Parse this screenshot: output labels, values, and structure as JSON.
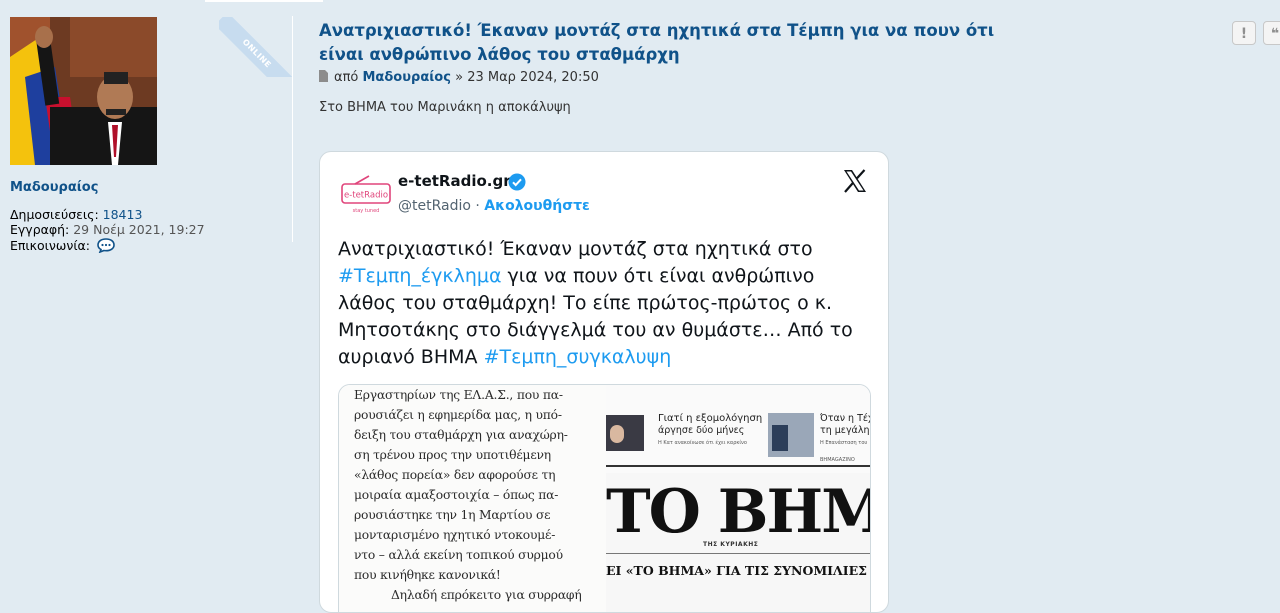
{
  "profile": {
    "username": "Μαδουραίος",
    "online_badge": "ONLINE",
    "fields": [
      {
        "label": "Δημοσιεύσεις:",
        "value": "18413"
      },
      {
        "label": "Εγγραφή:",
        "value": "29 Νοέμ 2021, 19:27"
      },
      {
        "label": "Επικοινωνία:",
        "value": ""
      }
    ]
  },
  "post": {
    "title": "Ανατριχιαστικό! Έκαναν μοντάζ στα ηχητικά στα Τέμπη για να πουν ότι είναι ανθρώπινο λάθος του σταθμάρχη",
    "meta_prefix": "από",
    "author": "Μαδουραίος",
    "meta_sep": "»",
    "date": "23 Μαρ 2024, 20:50",
    "text": "Στο ΒΗΜΑ του Μαρινάκη η αποκάλυψη",
    "quick_buttons": [
      "!",
      "❝"
    ]
  },
  "tweet": {
    "account_name": "e-tetRadio.gr",
    "logo_text": "e-tetRadio",
    "logo_tagline": "stay tuned",
    "handle": "@tetRadio",
    "dot": "·",
    "follow_label": "Ακολουθήστε",
    "text_parts": {
      "p1": "Ανατριχιαστικό! Έκαναν μοντάζ στα ηχητικά στο ",
      "hash1": "#Τεμπη_έγκλημα",
      "p2": " για να πουν ότι είναι ανθρώπινο λάθος του σταθμάρχη! Το είπε πρώτος-πρώτος ο κ. Μητσοτάκης στο διάγγελμά του αν θυμάστε… Από το αυριανό ΒΗΜΑ ",
      "hash2": "#Τεμπη_συγκαλυψη"
    },
    "clipping_lines": [
      "Εργαστηρίων της ΕΛ.Α.Σ., που πα-",
      "ρουσιάζει η εφημερίδα μας, η υπό-",
      "δειξη του σταθμάρχη για αναχώρη-",
      "ση τρένου προς την υποτιθέμενη",
      "«λάθος πορεία» δεν αφορούσε τη",
      "μοιραία αμαξοστοιχία – όπως πα-",
      "ρουσιάστηκε την 1η Μαρτίου σε",
      "μονταρισμένο ηχητικό ντοκουμέ-",
      "ντο – αλλά εκείνη τοπικού συρμού",
      "που κινήθηκε κανονικά!",
      "Δηλαδή επρόκειτο για συρραφή"
    ],
    "newspaper": {
      "teaser1_title": "Γιατί η εξομολόγηση",
      "teaser1_sub": "άργησε δύο μήνες",
      "teaser1_small": "Η Κατ ανακοίνωσε ότι έχει καρκίνο",
      "teaser2_title": "Όταν η Τέχν",
      "teaser2_sub": "τη μεγάλη Ισ",
      "teaser2_small": "Η Επανάσταση του",
      "section": "ΒΗΜΑGAZINO",
      "masthead": "ΤΟ ΒΗΜΑ",
      "masthead_sub": "ΤΗΣ ΚΥΡΙΑΚΗΣ",
      "headline": "ΕΙ «ΤΟ ΒΗΜΑ» ΓΙΑ ΤΙΣ ΣΥΝΟΜΙΛΙΕΣ ΤΗ Μ"
    }
  },
  "colors": {
    "page_bg": "#e1ebf2",
    "link": "#105289",
    "twitter_blue": "#1d9bf0",
    "tweet_text": "#0f1419"
  }
}
